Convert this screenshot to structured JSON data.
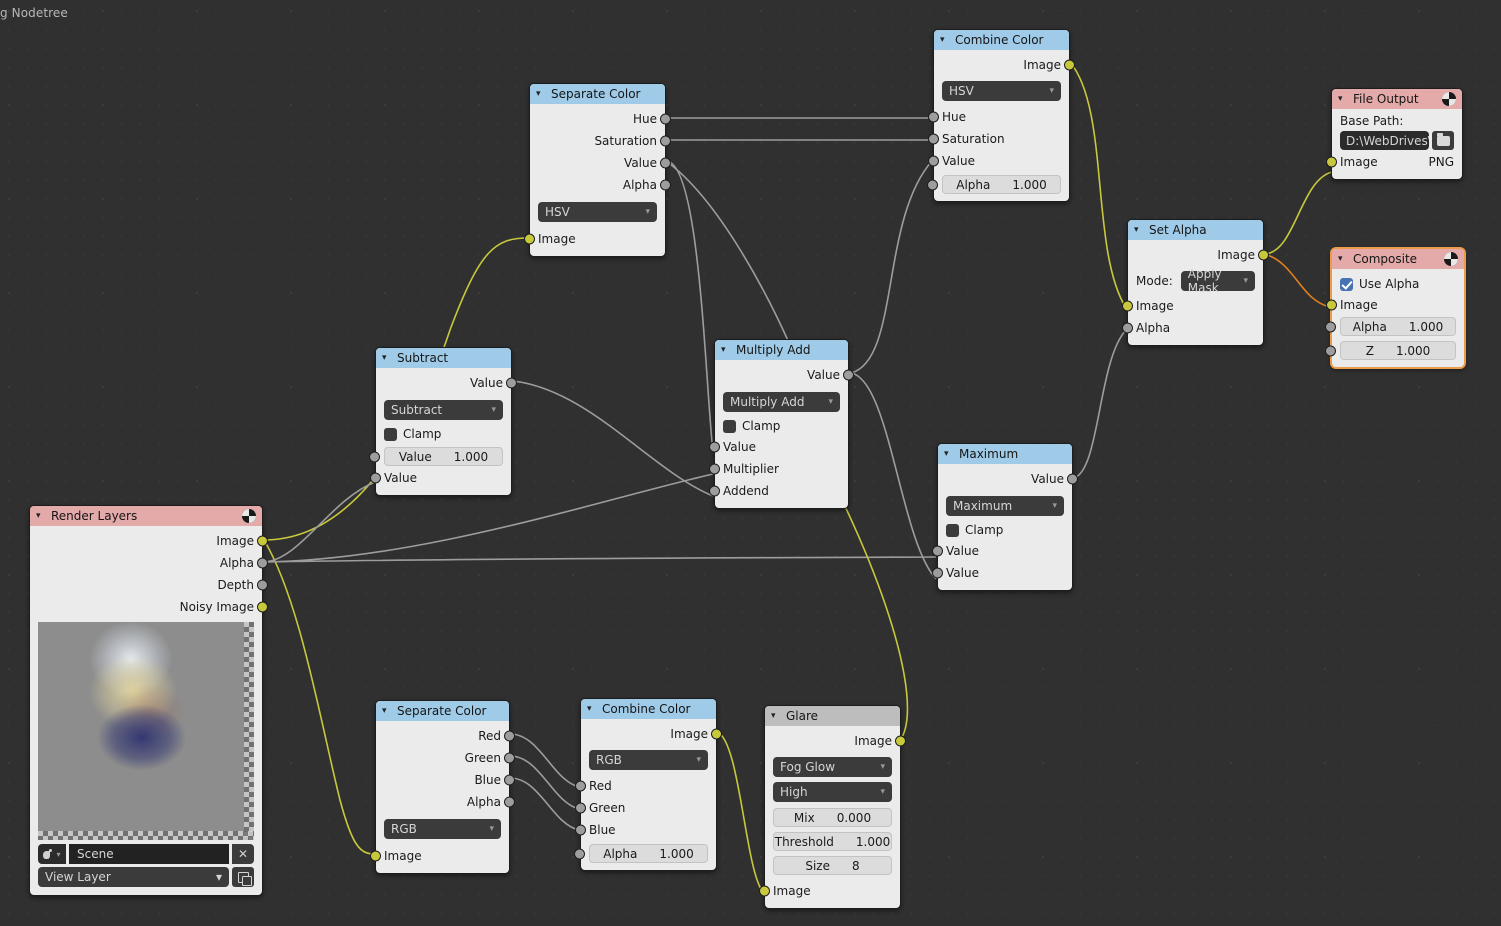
{
  "editor": {
    "header_label": "g Nodetree",
    "background": "#303030"
  },
  "colors": {
    "header_color_category": "#9fcbe8",
    "header_filter_category": "#bdbdbd",
    "header_output_category": "#e4a9a9",
    "socket_image": "#c8c83c",
    "socket_value": "#9d9d9d",
    "selected_outline": "#ed9b4b",
    "link_image": "#c8c83c",
    "link_value": "#9d9d9d",
    "link_highlight": "#e08020"
  },
  "nodes": {
    "combine_color_hsv": {
      "title": "Combine Color",
      "outputs": [
        {
          "label": "Image"
        }
      ],
      "mode": "HSV",
      "inputs": [
        {
          "label": "Hue"
        },
        {
          "label": "Saturation"
        },
        {
          "label": "Value"
        }
      ],
      "alpha": {
        "label": "Alpha",
        "value": "1.000"
      }
    },
    "separate_color_hsv": {
      "title": "Separate Color",
      "outputs": [
        {
          "label": "Hue"
        },
        {
          "label": "Saturation"
        },
        {
          "label": "Value"
        },
        {
          "label": "Alpha"
        }
      ],
      "mode": "HSV",
      "inputs": [
        {
          "label": "Image"
        }
      ]
    },
    "file_output": {
      "title": "File Output",
      "base_path_label": "Base Path:",
      "path_value": "D:\\WebDrives\\...",
      "folder_icon": "folder-icon",
      "image_label": "Image",
      "format": "PNG"
    },
    "set_alpha": {
      "title": "Set Alpha",
      "outputs": [
        {
          "label": "Image"
        }
      ],
      "mode_label": "Mode:",
      "mode_value": "Apply Mask",
      "inputs": [
        {
          "label": "Image"
        },
        {
          "label": "Alpha"
        }
      ]
    },
    "composite": {
      "title": "Composite",
      "use_alpha_label": "Use Alpha",
      "use_alpha_checked": true,
      "image_label": "Image",
      "fields": [
        {
          "label": "Alpha",
          "value": "1.000"
        },
        {
          "label": "Z",
          "value": "1.000"
        }
      ]
    },
    "subtract": {
      "title": "Subtract",
      "outputs": [
        {
          "label": "Value"
        }
      ],
      "operation": "Subtract",
      "clamp_label": "Clamp",
      "clamp_checked": false,
      "value_field": {
        "label": "Value",
        "value": "1.000"
      },
      "inputs": [
        {
          "label": "Value"
        }
      ]
    },
    "multiply_add": {
      "title": "Multiply Add",
      "outputs": [
        {
          "label": "Value"
        }
      ],
      "operation": "Multiply Add",
      "clamp_label": "Clamp",
      "clamp_checked": false,
      "inputs": [
        {
          "label": "Value"
        },
        {
          "label": "Multiplier"
        },
        {
          "label": "Addend"
        }
      ]
    },
    "maximum": {
      "title": "Maximum",
      "outputs": [
        {
          "label": "Value"
        }
      ],
      "operation": "Maximum",
      "clamp_label": "Clamp",
      "clamp_checked": false,
      "inputs": [
        {
          "label": "Value"
        },
        {
          "label": "Value"
        }
      ]
    },
    "render_layers": {
      "title": "Render Layers",
      "outputs": [
        {
          "label": "Image"
        },
        {
          "label": "Alpha"
        },
        {
          "label": "Depth"
        },
        {
          "label": "Noisy Image"
        }
      ],
      "scene_value": "Scene",
      "scene_clear_icon": "close-icon",
      "view_layer_value": "View Layer",
      "view_layer_copy_icon": "copy-icon"
    },
    "separate_color_rgb": {
      "title": "Separate Color",
      "outputs": [
        {
          "label": "Red"
        },
        {
          "label": "Green"
        },
        {
          "label": "Blue"
        },
        {
          "label": "Alpha"
        }
      ],
      "mode": "RGB",
      "inputs": [
        {
          "label": "Image"
        }
      ]
    },
    "combine_color_rgb": {
      "title": "Combine Color",
      "outputs": [
        {
          "label": "Image"
        }
      ],
      "mode": "RGB",
      "inputs": [
        {
          "label": "Red"
        },
        {
          "label": "Green"
        },
        {
          "label": "Blue"
        }
      ],
      "alpha": {
        "label": "Alpha",
        "value": "1.000"
      }
    },
    "glare": {
      "title": "Glare",
      "outputs": [
        {
          "label": "Image"
        }
      ],
      "glare_type": "Fog Glow",
      "quality": "High",
      "fields": [
        {
          "label": "Mix",
          "value": "0.000"
        },
        {
          "label": "Threshold",
          "value": "1.000"
        },
        {
          "label": "Size",
          "value": "8"
        }
      ],
      "inputs": [
        {
          "label": "Image"
        }
      ]
    }
  }
}
